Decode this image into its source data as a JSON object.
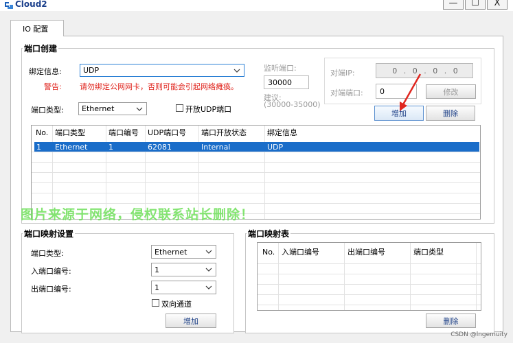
{
  "window": {
    "title": "Cloud2",
    "buttons": {
      "minimize": "—",
      "maximize": "☐",
      "close": "X"
    }
  },
  "tab": {
    "label": "IO 配置"
  },
  "port_create": {
    "title": "端口创建",
    "bind_label": "绑定信息:",
    "bind_value": "UDP",
    "warning_label": "警告:",
    "warning_text": "请勿绑定公网网卡，否则可能会引起网络瘫痪。",
    "port_type_label": "端口类型:",
    "port_type_value": "Ethernet",
    "open_udp_label": "开放UDP端口",
    "listen_port_label": "监听端口:",
    "listen_port_value": "30000",
    "suggest_label": "建议:",
    "suggest_range": "(30000-35000)",
    "remote_ip_label": "对端IP:",
    "remote_ip_value": "0 . 0 . 0 . 0",
    "remote_port_label": "对端端口:",
    "remote_port_value": "0",
    "modify_button": "修改",
    "add_button": "增加",
    "delete_button": "删除"
  },
  "port_table": {
    "columns": [
      "No.",
      "端口类型",
      "端口编号",
      "UDP端口号",
      "端口开放状态",
      "绑定信息"
    ],
    "rows": [
      {
        "no": "1",
        "type": "Ethernet",
        "num": "1",
        "udp": "62081",
        "status": "Internal",
        "bind": "UDP"
      }
    ]
  },
  "watermark": "图片来源于网络，侵权联系站长删除！",
  "mapping_settings": {
    "title": "端口映射设置",
    "port_type_label": "端口类型:",
    "port_type_value": "Ethernet",
    "in_port_label": "入端口编号:",
    "in_port_value": "1",
    "out_port_label": "出端口编号:",
    "out_port_value": "1",
    "bidirectional_label": "双向通道",
    "add_button": "增加"
  },
  "mapping_table": {
    "title": "端口映射表",
    "columns": [
      "No.",
      "入端口编号",
      "出端口编号",
      "端口类型"
    ],
    "delete_button": "删除"
  },
  "credit": "CSDN @lngemuity",
  "colors": {
    "selection": "#1a6dc9",
    "warning": "#e0261f",
    "accent": "#1c3f86"
  }
}
